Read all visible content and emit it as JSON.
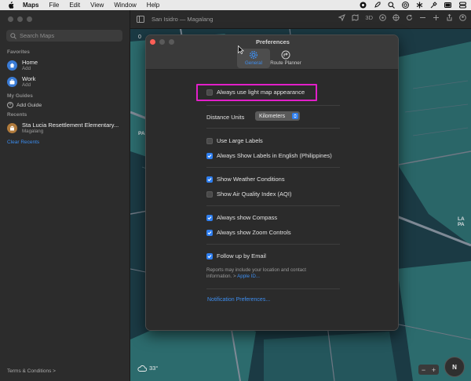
{
  "menubar": {
    "app": "Maps",
    "items": [
      "File",
      "Edit",
      "View",
      "Window",
      "Help"
    ]
  },
  "sidebar": {
    "search_placeholder": "Search Maps",
    "favorites_header": "Favorites",
    "favorites": [
      {
        "title": "Home",
        "subtitle": "Add",
        "icon": "home-icon"
      },
      {
        "title": "Work",
        "subtitle": "Add",
        "icon": "briefcase-icon"
      }
    ],
    "guides_header": "My Guides",
    "add_guide": "Add Guide",
    "recents_header": "Recents",
    "recent": {
      "title": "Sta Lucia Resettlement Elementary...",
      "subtitle": "Magalang"
    },
    "clear_recents": "Clear Recents",
    "terms": "Terms & Conditions >"
  },
  "map": {
    "title": "San Isidro — Magalang",
    "tool_3d": "3D",
    "labels": {
      "pa": "PA",
      "la_pa": "LA PA",
      "zero": "0"
    },
    "weather": "33°",
    "compass": "N"
  },
  "preferences": {
    "title": "Preferences",
    "tabs": [
      {
        "label": "General",
        "icon": "gear-icon",
        "selected": true
      },
      {
        "label": "Route Planner",
        "icon": "route-icon",
        "selected": false
      }
    ],
    "light_map": {
      "label": "Always use light map appearance",
      "checked": false
    },
    "distance_units": {
      "label": "Distance Units",
      "value": "Kilometers"
    },
    "large_labels": {
      "label": "Use Large Labels",
      "checked": false
    },
    "english_labels": {
      "label": "Always Show Labels in English (Philippines)",
      "checked": true
    },
    "weather": {
      "label": "Show Weather Conditions",
      "checked": true
    },
    "aqi": {
      "label": "Show Air Quality Index (AQI)",
      "checked": false
    },
    "compass": {
      "label": "Always show Compass",
      "checked": true
    },
    "zoom": {
      "label": "Always show Zoom Controls",
      "checked": true
    },
    "followup": {
      "label": "Follow up by Email",
      "checked": true
    },
    "note": "Reports may include your location and contact information. >",
    "note_link": "Apple ID...",
    "notification_link": "Notification Preferences..."
  },
  "colors": {
    "accent": "#2f7ff0",
    "highlight": "#e21fc9",
    "map_water": "#1b3a44",
    "map_land": "#2c6b6d"
  }
}
